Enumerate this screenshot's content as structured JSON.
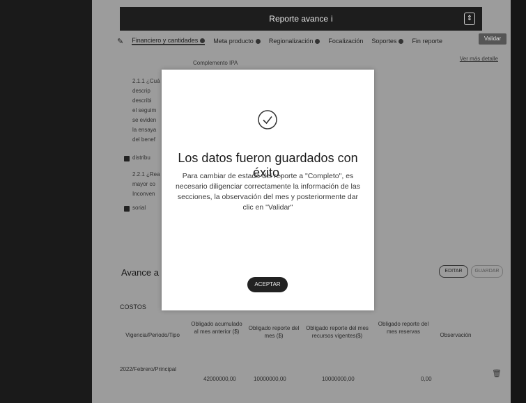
{
  "header": {
    "title": "Reporte avance",
    "title_icon": "i"
  },
  "tabs": [
    {
      "label": "Financiero y cantidades"
    },
    {
      "label": "Meta producto"
    },
    {
      "label": "Regionalización"
    },
    {
      "label": "Focalización"
    },
    {
      "label": "Soportes"
    },
    {
      "label": "Fin reporte"
    }
  ],
  "toolbar": {
    "validar_label": "Validar",
    "top_link": "Ver más detalle"
  },
  "content": {
    "subtitle": "Complemento IPA",
    "section_a": [
      "2.1.1 ¿Cuá",
      "descrip",
      "describi",
      "el seguim",
      "se eviden",
      "la ensaya",
      "del benef",
      "distribu"
    ],
    "section_b": [
      "2.2.1 ¿Rea",
      "mayor co",
      "Inconven",
      "sorial"
    ]
  },
  "avance": {
    "title": "Avance a",
    "editar": "EDITAR",
    "guardar": "GUARDAR"
  },
  "costos": {
    "title": "COSTOS",
    "headers": [
      "Vigencia/Periodo/Tipo",
      "Obligado acumulado al mes anterior ($)",
      "Obligado reporte del mes ($)",
      "Obligado reporte del mes recursos vigentes($)",
      "Obligado reporte del mes reservas",
      "Observación"
    ],
    "row": {
      "vigencia": "2022/Febrero/Principal",
      "acumulado": "42000000,00",
      "reporte": "10000000,00",
      "vigentes": "10000000,00",
      "reservas": "0,00"
    }
  },
  "modal": {
    "title": "Los datos fueron guardados con éxito.",
    "body": "Para cambiar de estado del reporte a \"Completo\", es necesario diligenciar correctamente la información de las secciones, la observación del mes y posteriormente dar clic en \"Validar\"",
    "button": "ACEPTAR"
  }
}
